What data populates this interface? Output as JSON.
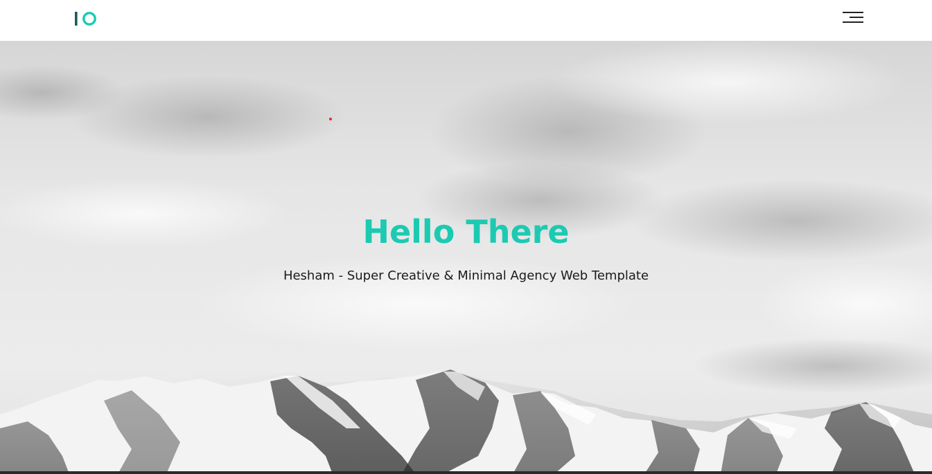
{
  "header": {
    "logo_text": "IO",
    "logo_icon": "io-logo-icon",
    "menu_icon": "hamburger-menu-icon"
  },
  "hero": {
    "title": "Hello There",
    "subtitle": "Hesham - Super Creative & Minimal Agency Web Template",
    "background": "snowy-mountains-cloudy-sky"
  },
  "colors": {
    "accent": "#1ccab2",
    "logo_bar": "#1a5c5a",
    "text_dark": "#1a1a1a",
    "header_bg": "#ffffff"
  }
}
